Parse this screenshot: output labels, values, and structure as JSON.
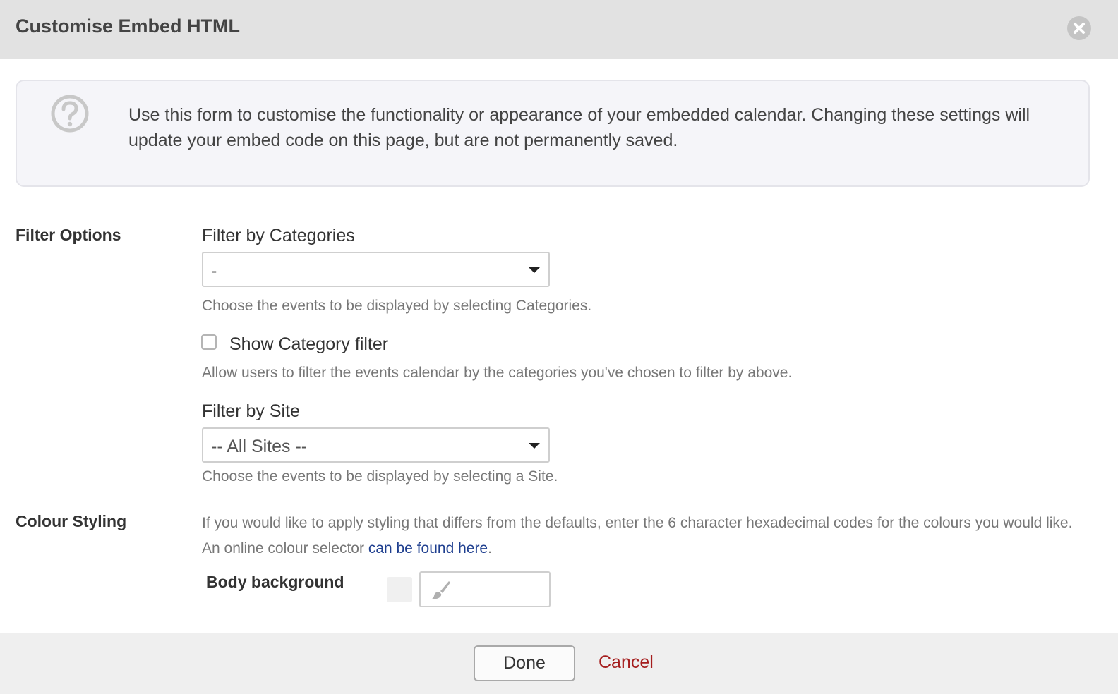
{
  "dialog": {
    "title": "Customise Embed HTML"
  },
  "info": {
    "text": "Use this form to customise the functionality or appearance of your embedded calendar. Changing these settings will update your embed code on this page, but are not permanently saved."
  },
  "filter_options": {
    "section_label": "Filter Options",
    "categories": {
      "label": "Filter by Categories",
      "selected_value": "-",
      "help": "Choose the events to be displayed by selecting Categories."
    },
    "show_category_filter": {
      "label": "Show Category filter",
      "checked": false,
      "help": "Allow users to filter the events calendar by the categories you've chosen to filter by above."
    },
    "site": {
      "label": "Filter by Site",
      "selected_value": "-- All Sites --",
      "help": "Choose the events to be displayed by selecting a Site."
    }
  },
  "colour_styling": {
    "section_label": "Colour Styling",
    "intro_text": "If you would like to apply styling that differs from the defaults, enter the 6 character hexadecimal codes for the colours you would like. An online colour selector ",
    "link_text": "can be found here",
    "intro_end": ".",
    "body_background": {
      "label": "Body background",
      "value": "",
      "icon": "paintbrush-icon"
    }
  },
  "footer": {
    "done_label": "Done",
    "cancel_label": "Cancel"
  },
  "colors": {
    "header_bg": "#e2e2e2",
    "info_bg": "#f5f5f9",
    "link": "#1f3f8f",
    "cancel": "#a51d1d"
  }
}
